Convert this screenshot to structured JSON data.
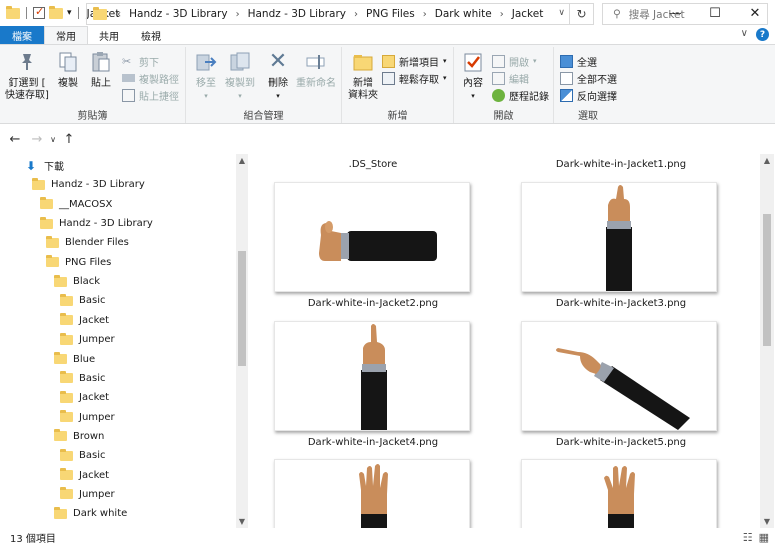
{
  "window": {
    "title": "Jacket",
    "minimize": "—",
    "maximize": "☐",
    "close": "✕"
  },
  "tabs": [
    {
      "label": "檔案"
    },
    {
      "label": "常用"
    },
    {
      "label": "共用"
    },
    {
      "label": "檢視"
    }
  ],
  "ribbon_tools": {
    "chevron": "∨",
    "help": "?"
  },
  "ribbon": {
    "clipboard": {
      "label": "剪貼簿",
      "pin": "釘選到 [\n快速存取]",
      "copy": "複製",
      "paste": "貼上",
      "cut": "剪下",
      "copy_path": "複製路徑",
      "paste_shortcut": "貼上捷徑"
    },
    "organize": {
      "label": "組合管理",
      "move_to": "移至",
      "copy_to": "複製到",
      "delete": "刪除",
      "rename": "重新命名"
    },
    "new": {
      "label": "新增",
      "new_folder": "新增\n資料夾",
      "new_item": "新增項目",
      "easy_access": "輕鬆存取"
    },
    "open": {
      "label": "開啟",
      "properties": "內容",
      "open": "開啟",
      "edit": "編輯",
      "history": "歷程記錄"
    },
    "select": {
      "label": "選取",
      "select_all": "全選",
      "select_none": "全部不選",
      "invert": "反向選擇"
    }
  },
  "address": {
    "prefix": "«",
    "crumbs": [
      "Handz - 3D Library",
      "Handz - 3D Library",
      "PNG Files",
      "Dark white",
      "Jacket"
    ],
    "search_placeholder": "搜尋 Jacket"
  },
  "tree": [
    {
      "label": "下載",
      "indent": 0,
      "kind": "download"
    },
    {
      "label": "Handz - 3D Library",
      "indent": 1
    },
    {
      "label": "__MACOSX",
      "indent": 2
    },
    {
      "label": "Handz - 3D Library",
      "indent": 2
    },
    {
      "label": "Blender Files",
      "indent": 3
    },
    {
      "label": "PNG Files",
      "indent": 3
    },
    {
      "label": "Black",
      "indent": 4
    },
    {
      "label": "Basic",
      "indent": 5
    },
    {
      "label": "Jacket",
      "indent": 5
    },
    {
      "label": "Jumper",
      "indent": 5
    },
    {
      "label": "Blue",
      "indent": 4
    },
    {
      "label": "Basic",
      "indent": 5
    },
    {
      "label": "Jacket",
      "indent": 5
    },
    {
      "label": "Jumper",
      "indent": 5
    },
    {
      "label": "Brown",
      "indent": 4
    },
    {
      "label": "Basic",
      "indent": 5
    },
    {
      "label": "Jacket",
      "indent": 5
    },
    {
      "label": "Jumper",
      "indent": 5
    },
    {
      "label": "Dark white",
      "indent": 4
    }
  ],
  "files": {
    "top_row": [
      ".DS_Store",
      "Dark-white-in-Jacket1.png"
    ],
    "row1": [
      "Dark-white-in-Jacket2.png",
      "Dark-white-in-Jacket3.png"
    ],
    "row2": [
      "Dark-white-in-Jacket4.png",
      "Dark-white-in-Jacket5.png"
    ]
  },
  "status": {
    "count": "13 個項目"
  },
  "colors": {
    "accent": "#1979ca",
    "folder": "#f8d775",
    "ribbon_bg": "#f5f6f7"
  }
}
